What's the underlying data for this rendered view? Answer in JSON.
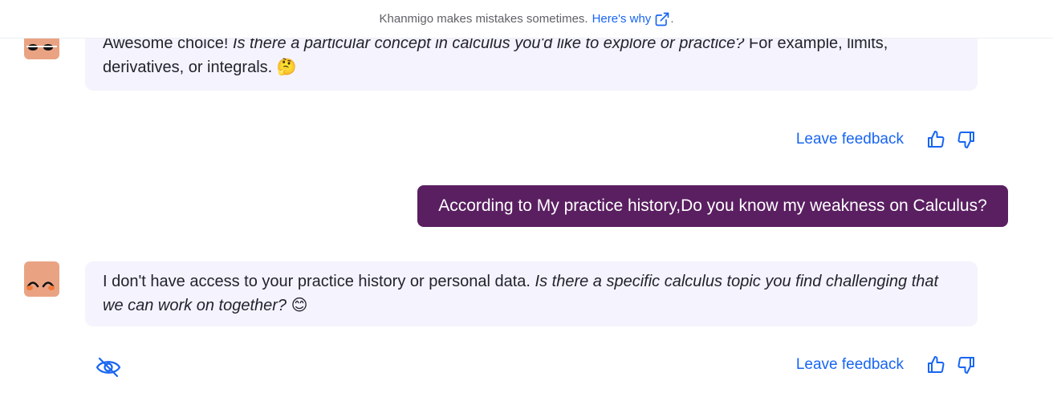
{
  "banner": {
    "text": "Khanmigo makes mistakes sometimes.",
    "link_label": "Here's why",
    "trailing": "."
  },
  "messages": [
    {
      "role": "assistant",
      "plain": "Awesome choice! ",
      "italic": "Is there a particular concept in calculus you'd like to explore or practice?",
      "plain_after": " For example, limits, derivatives, or integrals. ",
      "emoji": "🤔"
    },
    {
      "role": "user",
      "text": "According to My practice history,Do you know my weakness on Calculus?"
    },
    {
      "role": "assistant",
      "plain": "I don't have access to your practice history or personal data. ",
      "italic": "Is there a specific calculus topic you find challenging that we can work on together?",
      "emoji": "😊"
    }
  ],
  "feedback": {
    "label": "Leave feedback"
  },
  "icons": {
    "external_link": "external-link-icon",
    "thumbs_up": "thumbs-up-icon",
    "thumbs_down": "thumbs-down-icon",
    "hide": "eye-off-icon"
  },
  "colors": {
    "link": "#1865f2",
    "user_bubble": "#5a1f61",
    "bot_bubble": "#f5f3fd",
    "avatar": "#e9a383"
  }
}
